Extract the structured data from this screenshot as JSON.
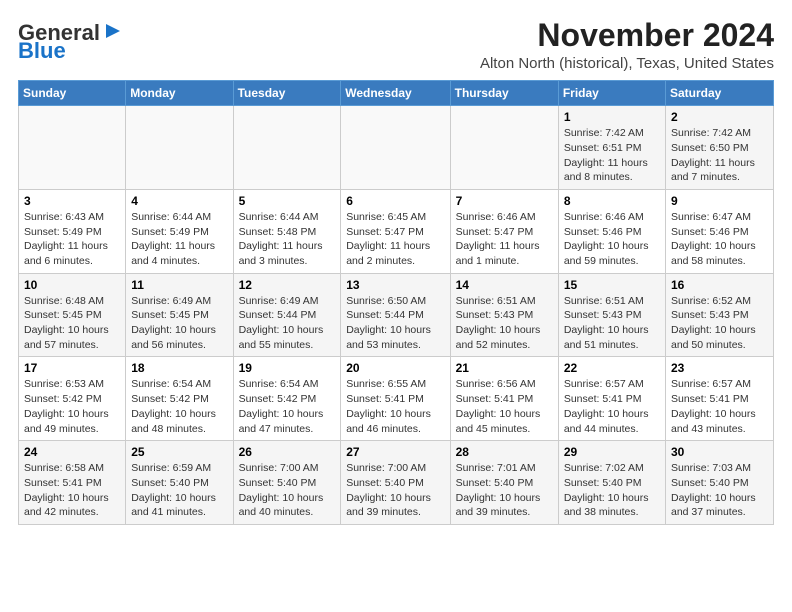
{
  "header": {
    "logo_general": "General",
    "logo_blue": "Blue",
    "month_title": "November 2024",
    "location": "Alton North (historical), Texas, United States"
  },
  "days_of_week": [
    "Sunday",
    "Monday",
    "Tuesday",
    "Wednesday",
    "Thursday",
    "Friday",
    "Saturday"
  ],
  "weeks": [
    [
      {
        "num": "",
        "info": ""
      },
      {
        "num": "",
        "info": ""
      },
      {
        "num": "",
        "info": ""
      },
      {
        "num": "",
        "info": ""
      },
      {
        "num": "",
        "info": ""
      },
      {
        "num": "1",
        "info": "Sunrise: 7:42 AM\nSunset: 6:51 PM\nDaylight: 11 hours and 8 minutes."
      },
      {
        "num": "2",
        "info": "Sunrise: 7:42 AM\nSunset: 6:50 PM\nDaylight: 11 hours and 7 minutes."
      }
    ],
    [
      {
        "num": "3",
        "info": "Sunrise: 6:43 AM\nSunset: 5:49 PM\nDaylight: 11 hours and 6 minutes."
      },
      {
        "num": "4",
        "info": "Sunrise: 6:44 AM\nSunset: 5:49 PM\nDaylight: 11 hours and 4 minutes."
      },
      {
        "num": "5",
        "info": "Sunrise: 6:44 AM\nSunset: 5:48 PM\nDaylight: 11 hours and 3 minutes."
      },
      {
        "num": "6",
        "info": "Sunrise: 6:45 AM\nSunset: 5:47 PM\nDaylight: 11 hours and 2 minutes."
      },
      {
        "num": "7",
        "info": "Sunrise: 6:46 AM\nSunset: 5:47 PM\nDaylight: 11 hours and 1 minute."
      },
      {
        "num": "8",
        "info": "Sunrise: 6:46 AM\nSunset: 5:46 PM\nDaylight: 10 hours and 59 minutes."
      },
      {
        "num": "9",
        "info": "Sunrise: 6:47 AM\nSunset: 5:46 PM\nDaylight: 10 hours and 58 minutes."
      }
    ],
    [
      {
        "num": "10",
        "info": "Sunrise: 6:48 AM\nSunset: 5:45 PM\nDaylight: 10 hours and 57 minutes."
      },
      {
        "num": "11",
        "info": "Sunrise: 6:49 AM\nSunset: 5:45 PM\nDaylight: 10 hours and 56 minutes."
      },
      {
        "num": "12",
        "info": "Sunrise: 6:49 AM\nSunset: 5:44 PM\nDaylight: 10 hours and 55 minutes."
      },
      {
        "num": "13",
        "info": "Sunrise: 6:50 AM\nSunset: 5:44 PM\nDaylight: 10 hours and 53 minutes."
      },
      {
        "num": "14",
        "info": "Sunrise: 6:51 AM\nSunset: 5:43 PM\nDaylight: 10 hours and 52 minutes."
      },
      {
        "num": "15",
        "info": "Sunrise: 6:51 AM\nSunset: 5:43 PM\nDaylight: 10 hours and 51 minutes."
      },
      {
        "num": "16",
        "info": "Sunrise: 6:52 AM\nSunset: 5:43 PM\nDaylight: 10 hours and 50 minutes."
      }
    ],
    [
      {
        "num": "17",
        "info": "Sunrise: 6:53 AM\nSunset: 5:42 PM\nDaylight: 10 hours and 49 minutes."
      },
      {
        "num": "18",
        "info": "Sunrise: 6:54 AM\nSunset: 5:42 PM\nDaylight: 10 hours and 48 minutes."
      },
      {
        "num": "19",
        "info": "Sunrise: 6:54 AM\nSunset: 5:42 PM\nDaylight: 10 hours and 47 minutes."
      },
      {
        "num": "20",
        "info": "Sunrise: 6:55 AM\nSunset: 5:41 PM\nDaylight: 10 hours and 46 minutes."
      },
      {
        "num": "21",
        "info": "Sunrise: 6:56 AM\nSunset: 5:41 PM\nDaylight: 10 hours and 45 minutes."
      },
      {
        "num": "22",
        "info": "Sunrise: 6:57 AM\nSunset: 5:41 PM\nDaylight: 10 hours and 44 minutes."
      },
      {
        "num": "23",
        "info": "Sunrise: 6:57 AM\nSunset: 5:41 PM\nDaylight: 10 hours and 43 minutes."
      }
    ],
    [
      {
        "num": "24",
        "info": "Sunrise: 6:58 AM\nSunset: 5:41 PM\nDaylight: 10 hours and 42 minutes."
      },
      {
        "num": "25",
        "info": "Sunrise: 6:59 AM\nSunset: 5:40 PM\nDaylight: 10 hours and 41 minutes."
      },
      {
        "num": "26",
        "info": "Sunrise: 7:00 AM\nSunset: 5:40 PM\nDaylight: 10 hours and 40 minutes."
      },
      {
        "num": "27",
        "info": "Sunrise: 7:00 AM\nSunset: 5:40 PM\nDaylight: 10 hours and 39 minutes."
      },
      {
        "num": "28",
        "info": "Sunrise: 7:01 AM\nSunset: 5:40 PM\nDaylight: 10 hours and 39 minutes."
      },
      {
        "num": "29",
        "info": "Sunrise: 7:02 AM\nSunset: 5:40 PM\nDaylight: 10 hours and 38 minutes."
      },
      {
        "num": "30",
        "info": "Sunrise: 7:03 AM\nSunset: 5:40 PM\nDaylight: 10 hours and 37 minutes."
      }
    ]
  ]
}
